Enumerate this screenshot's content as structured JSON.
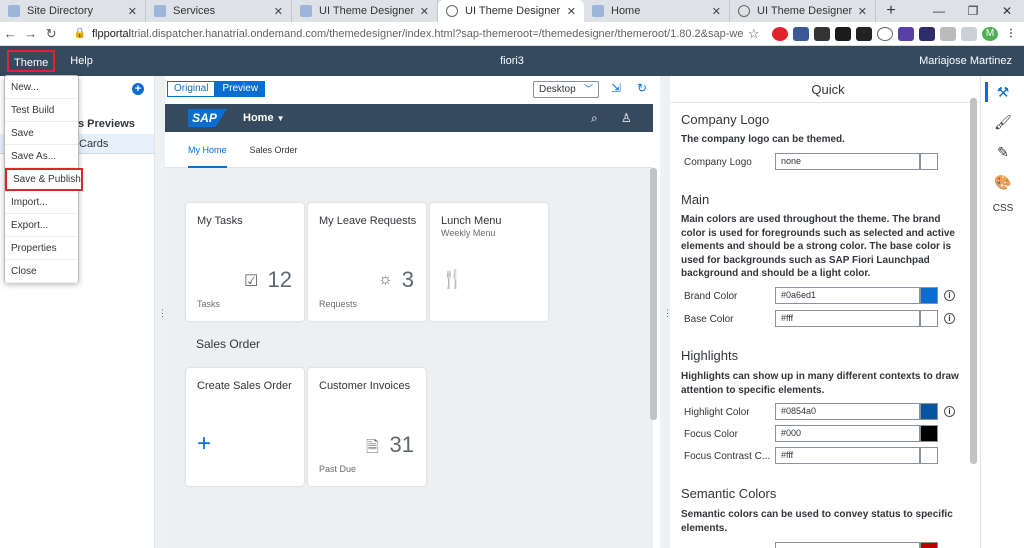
{
  "browser": {
    "tabs": [
      {
        "label": "Site Directory",
        "icon": "page-icon"
      },
      {
        "label": "Services",
        "icon": "page-icon"
      },
      {
        "label": "UI Theme Designer",
        "icon": "page-icon"
      },
      {
        "label": "UI Theme Designer",
        "icon": "globe-icon"
      },
      {
        "label": "Home",
        "icon": "page-icon"
      },
      {
        "label": "UI Theme Designer",
        "icon": "globe-icon"
      }
    ],
    "new_tab": "+",
    "url_host": "flpportal",
    "url_rest": "trial.dispatcher.hanatrial.ondemand.com/themedesigner/index.html?sap-themeroot=/themedesigner/themeroot/1.80.2&sap-webdav-th..."
  },
  "shell": {
    "menu_theme": "Theme",
    "menu_help": "Help",
    "title": "fiori3",
    "user": "Mariajose Martinez"
  },
  "theme_menu": {
    "items": [
      "New...",
      "Test Build",
      "Save",
      "Save As...",
      "Save & Publish",
      "Import...",
      "Export...",
      "Properties",
      "Close"
    ]
  },
  "left_panel": {
    "previews_label": "s Previews",
    "cards_label": "Cards"
  },
  "toolbar": {
    "original": "Original",
    "preview": "Preview",
    "device": "Desktop"
  },
  "fiori": {
    "logo": "SAP",
    "home": "Home",
    "subnav": [
      "My Home",
      "Sales Order"
    ],
    "tiles": [
      {
        "title": "My Tasks",
        "kpi": "12",
        "footer": "Tasks",
        "icon": "task-list-icon"
      },
      {
        "title": "My Leave Requests",
        "kpi": "3",
        "footer": "Requests",
        "icon": "leave-icon"
      },
      {
        "title": "Lunch Menu",
        "subtitle": "Weekly Menu",
        "icon": "cutlery-icon"
      }
    ],
    "group2_title": "Sales Order",
    "tiles2": [
      {
        "title": "Create Sales Order",
        "icon": "add-icon"
      },
      {
        "title": "Customer Invoices",
        "kpi": "31",
        "footer": "Past Due",
        "icon": "invoice-icon"
      }
    ]
  },
  "quick": {
    "heading": "Quick",
    "company_logo": {
      "title": "Company Logo",
      "desc": "The company logo can be themed.",
      "label": "Company Logo",
      "value": "none"
    },
    "main": {
      "title": "Main",
      "desc": "Main colors are used throughout the theme. The brand color is used for foregrounds such as selected and active elements and should be a strong color. The base color is used for backgrounds such as SAP Fiori Launchpad background and should be a light color.",
      "brand_label": "Brand Color",
      "brand_value": "#0a6ed1",
      "base_label": "Base Color",
      "base_value": "#fff"
    },
    "highlights": {
      "title": "Highlights",
      "desc": "Highlights can show up in many different contexts to draw attention to specific elements.",
      "highlight_label": "Highlight Color",
      "highlight_value": "#0854a0",
      "focus_label": "Focus Color",
      "focus_value": "#000",
      "focus_contrast_label": "Focus Contrast C...",
      "focus_contrast_value": "#fff"
    },
    "semantic": {
      "title": "Semantic Colors",
      "desc": "Semantic colors can be used to convey status to specific elements."
    }
  },
  "rail": {
    "css_label": "CSS"
  },
  "colors": {
    "shell_bg": "#354a5f",
    "brand": "#0a6ed1",
    "highlight": "#0854a0",
    "red_outline": "#e1242b",
    "negative_swatch": "#bb0000"
  }
}
